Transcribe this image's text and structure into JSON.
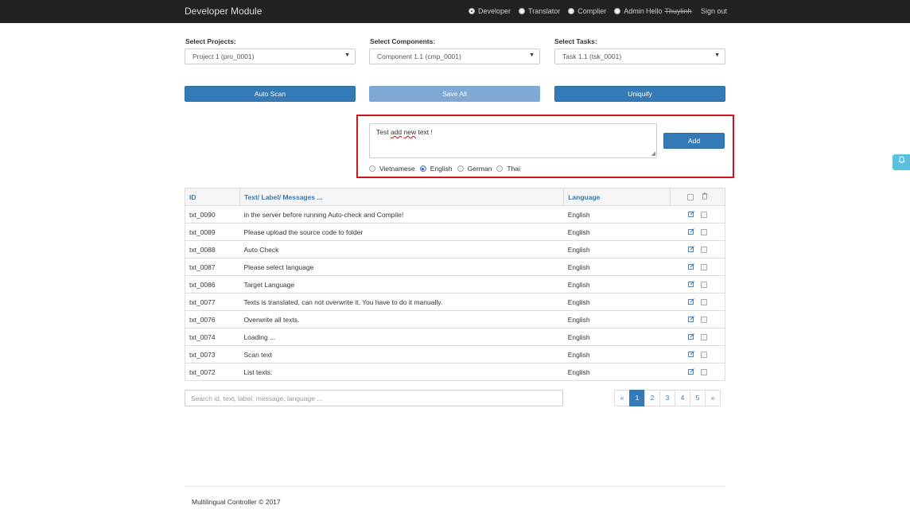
{
  "header": {
    "title": "Developer Module",
    "roles": [
      {
        "label": "Developer",
        "selected": true
      },
      {
        "label": "Translator",
        "selected": false
      },
      {
        "label": "Complier",
        "selected": false
      },
      {
        "label": "Admin",
        "selected": false
      }
    ],
    "hello": "Hello",
    "username": "Thuylinh",
    "signout": "Sign out"
  },
  "selectors": {
    "projects": {
      "label": "Select Projects:",
      "value": "Project 1 (pro_0001)"
    },
    "components": {
      "label": "Select Components:",
      "value": "Component 1.1 (cmp_0001)"
    },
    "tasks": {
      "label": "Select Tasks:",
      "value": "Task 1.1 (tsk_0001)"
    }
  },
  "actions": {
    "auto_scan": "Auto Scan",
    "save_all": "Save All",
    "uniquify": "Uniquify"
  },
  "add_form": {
    "text_before": "Test ",
    "text_misspelled_1": "add",
    "text_space": " ",
    "text_misspelled_2": "new",
    "text_after": " text !",
    "add_label": "Add",
    "languages": [
      {
        "label": "Vietnamese",
        "selected": false
      },
      {
        "label": "English",
        "selected": true
      },
      {
        "label": "German",
        "selected": false
      },
      {
        "label": "Thai",
        "selected": false
      }
    ]
  },
  "table": {
    "headers": {
      "id": "ID",
      "text": "Text/ Label/ Messages ...",
      "language": "Language"
    },
    "rows": [
      {
        "id": "txt_0090",
        "text": "in the server before running Auto-check and Compile!",
        "language": "English"
      },
      {
        "id": "txt_0089",
        "text": "Please upload the source code to folder",
        "language": "English"
      },
      {
        "id": "txt_0088",
        "text": "Auto Check",
        "language": "English"
      },
      {
        "id": "txt_0087",
        "text": "Please select language",
        "language": "English"
      },
      {
        "id": "txt_0086",
        "text": "Target Language",
        "language": "English"
      },
      {
        "id": "txt_0077",
        "text": "Texts is translated, can not overwrite it. You have to do it manually.",
        "language": "English"
      },
      {
        "id": "txt_0076",
        "text": "Overwrite all texts.",
        "language": "English"
      },
      {
        "id": "txt_0074",
        "text": "Loading ...",
        "language": "English"
      },
      {
        "id": "txt_0073",
        "text": "Scan text",
        "language": "English"
      },
      {
        "id": "txt_0072",
        "text": "List texts:",
        "language": "English"
      }
    ]
  },
  "search": {
    "placeholder": "Search id, text, label, message, language ..."
  },
  "pagination": {
    "prev": "«",
    "pages": [
      "1",
      "2",
      "3",
      "4",
      "5"
    ],
    "active": "1",
    "next": "»"
  },
  "footer": {
    "text": "Multilingual Controller © 2017"
  },
  "colors": {
    "primary": "#337ab7",
    "navbar": "#222222",
    "highlight_border": "#d6111a",
    "notify": "#5bc0de"
  }
}
